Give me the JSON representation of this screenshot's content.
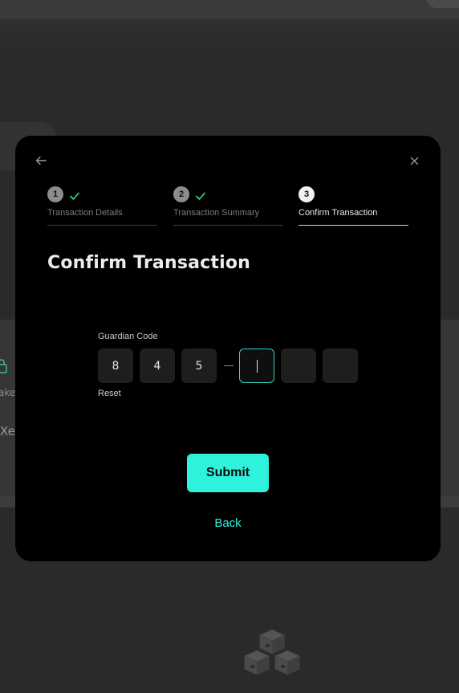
{
  "background": {
    "partial_text_1": "ake",
    "partial_text_2": "Xe",
    "icons": [
      "lock-icon",
      "cubes-icon"
    ]
  },
  "modal": {
    "icons": {
      "back": "arrow-left-icon",
      "close": "close-icon"
    },
    "steps": [
      {
        "number": "1",
        "label": "Transaction Details",
        "status": "done"
      },
      {
        "number": "2",
        "label": "Transaction Summary",
        "status": "done"
      },
      {
        "number": "3",
        "label": "Confirm Transaction",
        "status": "active"
      }
    ],
    "title": "Confirm Transaction",
    "guardian_code": {
      "label": "Guardian Code",
      "digits": [
        "8",
        "4",
        "5",
        "",
        "",
        ""
      ],
      "reset_label": "Reset"
    },
    "submit_label": "Submit",
    "back_label": "Back"
  },
  "colors": {
    "accent": "#2ef2dc",
    "modal_bg": "#000000",
    "page_bg": "#2a2a2a",
    "check": "#3ddc84"
  }
}
